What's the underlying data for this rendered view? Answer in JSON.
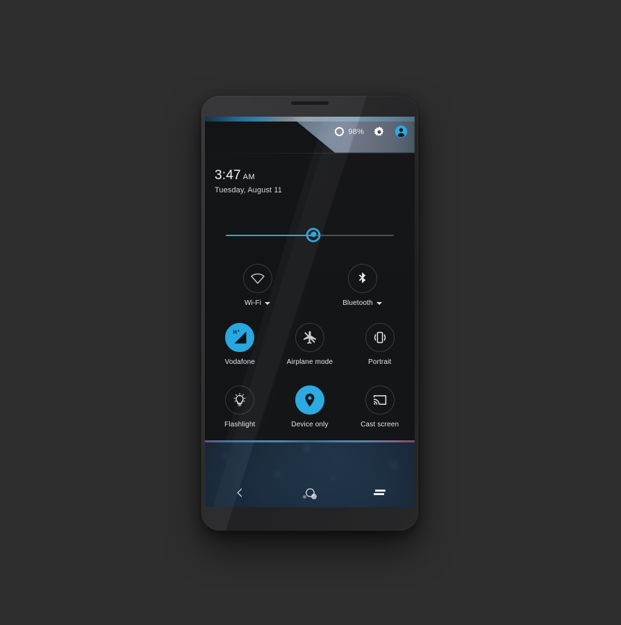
{
  "device": {
    "name": "android-phone-mockup",
    "earpiece": "earpiece-speaker"
  },
  "statusbar": {
    "battery_icon": "battery-ring-icon",
    "battery_percent": "98%",
    "settings_icon": "gear-icon",
    "user_icon": "user-avatar-icon"
  },
  "clock": {
    "time": "3:47",
    "ampm": "AM",
    "date": "Tuesday, August 11"
  },
  "brightness": {
    "label": "brightness-slider",
    "value": 52,
    "fill_color": "#28a8e0",
    "track_color": "#4c4c4c"
  },
  "tiles": {
    "row1": [
      {
        "label": "Wi-Fi",
        "icon": "wifi-icon",
        "state": "off",
        "has_caret": true
      },
      {
        "label": "Bluetooth",
        "icon": "bluetooth-icon",
        "state": "off",
        "has_caret": true
      }
    ],
    "row2": [
      {
        "label": "Vodafone",
        "icon": "cellular-signal-icon",
        "badge": "H+",
        "state": "on",
        "has_caret": false
      },
      {
        "label": "Airplane mode",
        "icon": "airplane-off-icon",
        "state": "off",
        "has_caret": false
      },
      {
        "label": "Portrait",
        "icon": "rotation-lock-icon",
        "state": "off",
        "has_caret": false
      }
    ],
    "row3": [
      {
        "label": "Flashlight",
        "icon": "flashlight-icon",
        "state": "off",
        "has_caret": false
      },
      {
        "label": "Device only",
        "icon": "location-pin-icon",
        "state": "on",
        "has_caret": false
      },
      {
        "label": "Cast screen",
        "icon": "cast-screen-icon",
        "state": "off",
        "has_caret": false
      }
    ]
  },
  "home": {
    "page_dots": 2,
    "active_dot_index": 1
  },
  "navbar": [
    {
      "name": "back",
      "icon": "back-chevron-icon"
    },
    {
      "name": "home",
      "icon": "home-circle-icon"
    },
    {
      "name": "recents",
      "icon": "recents-icon"
    }
  ],
  "colors": {
    "accent": "#28a8e0",
    "panel_bg": "#0a0b0d",
    "body_bg": "#2e2e2e",
    "text_primary": "#f2f4f6",
    "text_secondary": "#d2d6da"
  }
}
